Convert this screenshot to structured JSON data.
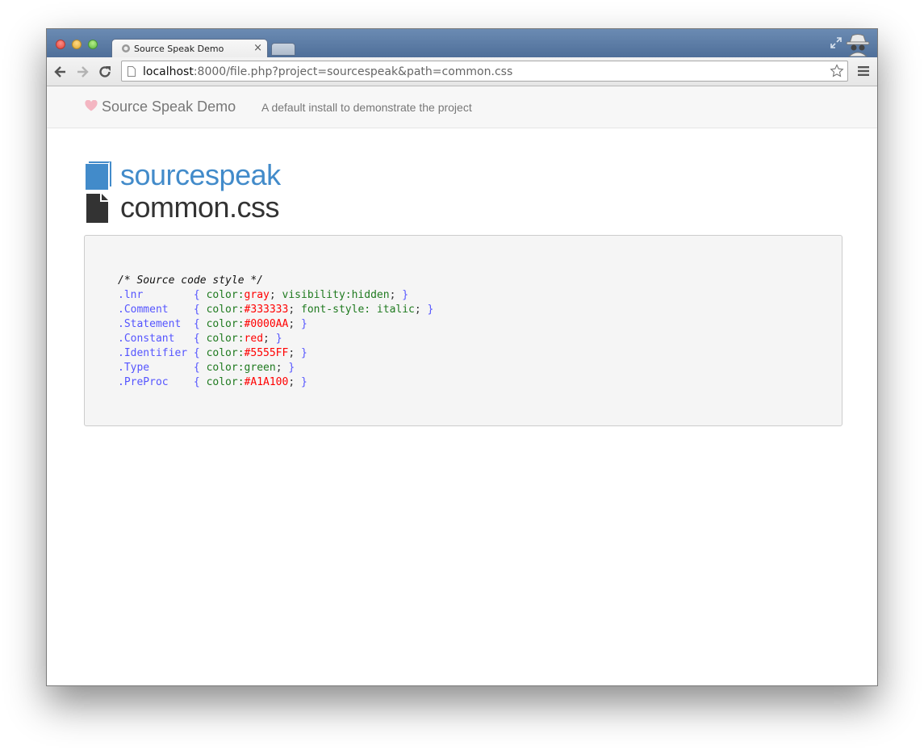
{
  "browser": {
    "tab_title": "Source Speak Demo",
    "tab_close": "×",
    "url_host": "localhost",
    "url_rest": ":8000/file.php?project=sourcespeak&path=common.css"
  },
  "navbar": {
    "brand": "Source Speak Demo",
    "description": "A default install to demonstrate the project"
  },
  "header": {
    "project": "sourcespeak",
    "file": "common.css"
  },
  "code": {
    "comment": "/* Source code style */",
    "rules": [
      {
        "selector": ".lnr       ",
        "decls": [
          {
            "p": "color",
            "v": "gray",
            "kind": "val"
          },
          {
            "p": "visibility",
            "v": "hidden",
            "kind": "prop"
          }
        ]
      },
      {
        "selector": ".Comment   ",
        "decls": [
          {
            "p": "color",
            "v": "#333333",
            "kind": "val"
          },
          {
            "p": "font-style",
            "v": " italic",
            "kind": "prop"
          }
        ]
      },
      {
        "selector": ".Statement ",
        "decls": [
          {
            "p": "color",
            "v": "#0000AA",
            "kind": "val"
          }
        ]
      },
      {
        "selector": ".Constant  ",
        "decls": [
          {
            "p": "color",
            "v": "red",
            "kind": "val"
          }
        ]
      },
      {
        "selector": ".Identifier",
        "decls": [
          {
            "p": "color",
            "v": "#5555FF",
            "kind": "val"
          }
        ]
      },
      {
        "selector": ".Type      ",
        "decls": [
          {
            "p": "color",
            "v": "green",
            "kind": "prop"
          }
        ]
      },
      {
        "selector": ".PreProc   ",
        "decls": [
          {
            "p": "color",
            "v": "#A1A100",
            "kind": "val"
          }
        ]
      }
    ]
  },
  "icons": {
    "heart": "heart-icon",
    "book": "book-icon",
    "file": "file-icon"
  },
  "colors": {
    "accent": "#428bca",
    "heart": "#f4b6c2",
    "titlebar": "#5a7aa3"
  }
}
